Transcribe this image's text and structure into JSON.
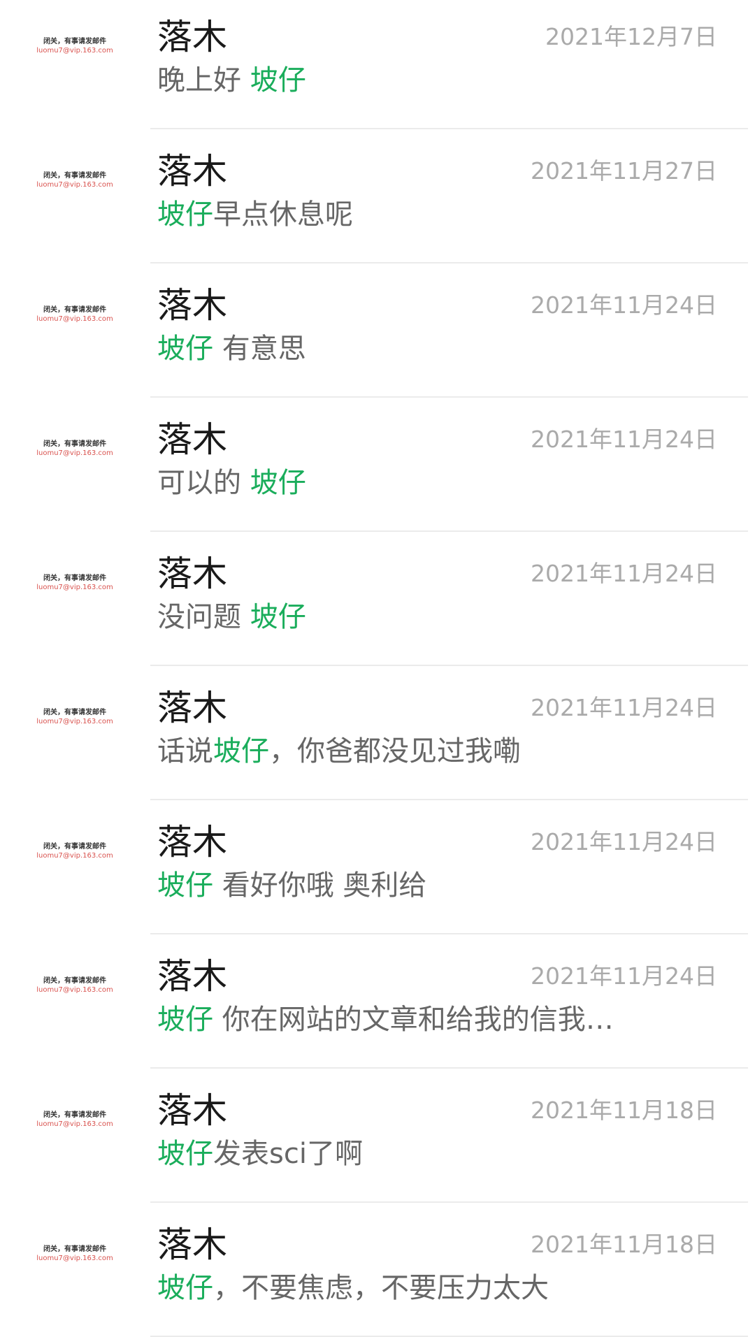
{
  "avatar": {
    "line1": "闭关，有事请发邮件",
    "line2": "luomu7@vip.163.com"
  },
  "messages": [
    {
      "name": "落木",
      "date": "2021年12月7日",
      "segments": [
        {
          "text": "晚上好 ",
          "hl": false
        },
        {
          "text": "坡仔",
          "hl": true
        }
      ]
    },
    {
      "name": "落木",
      "date": "2021年11月27日",
      "segments": [
        {
          "text": "坡仔",
          "hl": true
        },
        {
          "text": "早点休息呢",
          "hl": false
        }
      ]
    },
    {
      "name": "落木",
      "date": "2021年11月24日",
      "segments": [
        {
          "text": "坡仔",
          "hl": true
        },
        {
          "text": " 有意思",
          "hl": false
        }
      ]
    },
    {
      "name": "落木",
      "date": "2021年11月24日",
      "segments": [
        {
          "text": "可以的 ",
          "hl": false
        },
        {
          "text": "坡仔",
          "hl": true
        }
      ]
    },
    {
      "name": "落木",
      "date": "2021年11月24日",
      "segments": [
        {
          "text": "没问题 ",
          "hl": false
        },
        {
          "text": "坡仔",
          "hl": true
        }
      ]
    },
    {
      "name": "落木",
      "date": "2021年11月24日",
      "segments": [
        {
          "text": "话说",
          "hl": false
        },
        {
          "text": "坡仔",
          "hl": true
        },
        {
          "text": "，你爸都没见过我嘞",
          "hl": false
        }
      ]
    },
    {
      "name": "落木",
      "date": "2021年11月24日",
      "segments": [
        {
          "text": "坡仔",
          "hl": true
        },
        {
          "text": " 看好你哦  奥利给",
          "hl": false
        }
      ]
    },
    {
      "name": "落木",
      "date": "2021年11月24日",
      "segments": [
        {
          "text": "坡仔",
          "hl": true
        },
        {
          "text": "  你在网站的文章和给我的信我…",
          "hl": false
        }
      ]
    },
    {
      "name": "落木",
      "date": "2021年11月18日",
      "segments": [
        {
          "text": "坡仔",
          "hl": true
        },
        {
          "text": "发表sci了啊",
          "hl": false
        }
      ]
    },
    {
      "name": "落木",
      "date": "2021年11月18日",
      "segments": [
        {
          "text": "坡仔",
          "hl": true
        },
        {
          "text": "，不要焦虑，不要压力太大",
          "hl": false
        }
      ]
    }
  ]
}
